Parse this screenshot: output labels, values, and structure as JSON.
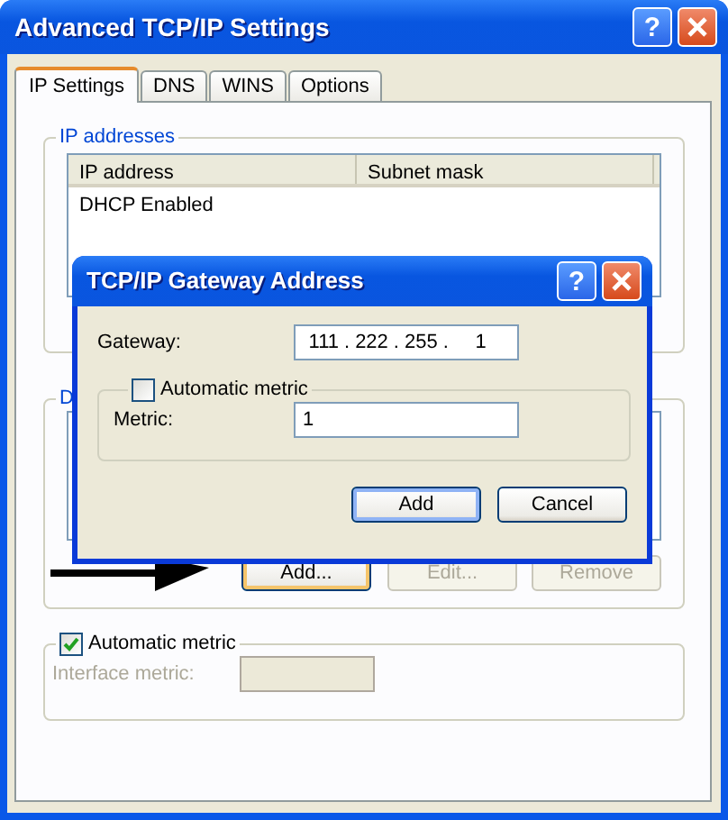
{
  "window": {
    "title": "Advanced TCP/IP Settings",
    "help": "?"
  },
  "tabs": [
    {
      "label": "IP Settings",
      "selected": true
    },
    {
      "label": "DNS",
      "selected": false
    },
    {
      "label": "WINS",
      "selected": false
    },
    {
      "label": "Options",
      "selected": false
    }
  ],
  "ip_addresses": {
    "label": "IP addresses",
    "columns": [
      "IP address",
      "Subnet mask"
    ],
    "rows": [
      [
        "DHCP Enabled"
      ]
    ]
  },
  "gateways": {
    "label": "D",
    "buttons": [
      {
        "label": "Add...",
        "disabled": false,
        "focused": true
      },
      {
        "label": "Edit...",
        "disabled": true,
        "focused": false
      },
      {
        "label": "Remove",
        "disabled": true,
        "focused": false
      }
    ]
  },
  "metric": {
    "label": "Automatic metric",
    "checked": true,
    "field_label": "Interface metric:",
    "disabled": true
  },
  "dialog": {
    "title": "TCP/IP Gateway Address",
    "help": "?",
    "gateway_label": "Gateway:",
    "gateway_octets": [
      "111",
      "222",
      "255",
      "1"
    ],
    "separator": ".",
    "automatic_metric": {
      "label": "Automatic metric",
      "checked": false
    },
    "metric_label": "Metric:",
    "metric_value": "1",
    "buttons": [
      {
        "label": "Add",
        "default": true
      },
      {
        "label": "Cancel",
        "default": false
      }
    ]
  }
}
